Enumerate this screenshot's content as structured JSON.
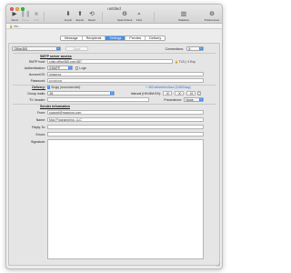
{
  "window": {
    "title": "untitled"
  },
  "toolbar": {
    "send": "Send",
    "pause": "Pause",
    "stop": "Stop",
    "import": "Import",
    "export": "Export",
    "reset": "Reset",
    "spamcheck": "SpamCheck",
    "find": "Find",
    "statistics": "Statistics",
    "preferences": "Preferences"
  },
  "pathbar": {
    "text": "Ido..."
  },
  "tabs": [
    "Message",
    "Recipients",
    "Settings",
    "Preview",
    "Delivery"
  ],
  "account": {
    "preset": "Office365",
    "save_label": "Save",
    "connections_label": "Connections:",
    "connections_value": "8"
  },
  "smtp": {
    "section": "SMTP server access",
    "host_label": "SMTP host:",
    "host_value": "smtp.office365.com:587",
    "tls_label": "TLS (~1 Exp",
    "auth_label": "Authentication:",
    "auth_value": "ESMTP",
    "login_label": "Login",
    "account_label": "Account ID:",
    "account_value": "maxprog",
    "password_label": "Password:",
    "password_value": "••••••••••••"
  },
  "delivery": {
    "label": "Delivery:",
    "singly_label": "Singly (recommended)",
    "rate": "+ 450 deliveries/hour (9,800/day)",
    "group_label": "Group mails:",
    "group_value": "25",
    "interval_label": "Interval (HH:MM:SS):",
    "hh": "00",
    "mm": "00",
    "ss": "45",
    "to_label": "'To' header:",
    "precedence_label": "Precedence:",
    "precedence_value": "None"
  },
  "sender": {
    "section": "Sender information",
    "from_label": "From:",
    "from_value": "support@maxprog.com",
    "name_label": "Name:",
    "name_value": "Max Programming, LLC",
    "reply_label": "Reply-To:",
    "reply_value": "",
    "errors_label": "Errors:",
    "errors_value": "",
    "signature_label": "Signature:"
  },
  "colors": {
    "accent": "#3d8ef5",
    "panel": "#e5e5e5",
    "window": "#ececec"
  }
}
